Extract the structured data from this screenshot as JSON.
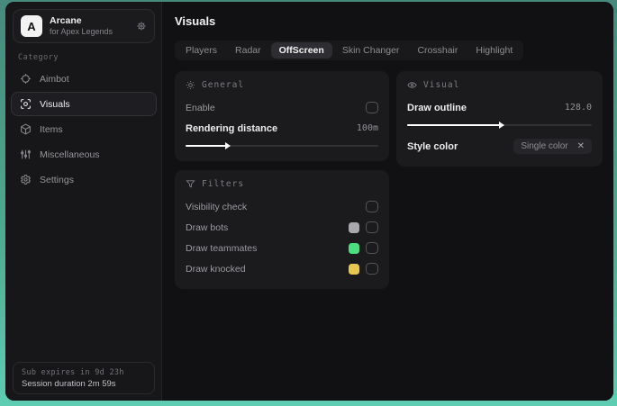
{
  "sidebar": {
    "app": {
      "logo_letter": "A",
      "name": "Arcane",
      "subtitle": "for Apex Legends"
    },
    "category_label": "Category",
    "items": [
      {
        "label": "Aimbot"
      },
      {
        "label": "Visuals"
      },
      {
        "label": "Items"
      },
      {
        "label": "Miscellaneous"
      },
      {
        "label": "Settings"
      }
    ],
    "footer": {
      "expires": "Sub expires in 9d 23h",
      "session": "Session duration 2m 59s"
    }
  },
  "main": {
    "title": "Visuals",
    "tabs": [
      {
        "label": "Players"
      },
      {
        "label": "Radar"
      },
      {
        "label": "OffScreen"
      },
      {
        "label": "Skin Changer"
      },
      {
        "label": "Crosshair"
      },
      {
        "label": "Highlight"
      }
    ],
    "general": {
      "title": "General",
      "enable_label": "Enable",
      "distance_label": "Rendering distance",
      "distance_value": "100m",
      "distance_fill": "21%"
    },
    "visual": {
      "title": "Visual",
      "outline_label": "Draw outline",
      "outline_value": "128.0",
      "outline_fill": "50%",
      "style_label": "Style color",
      "style_value": "Single color",
      "style_clear": "✕"
    },
    "filters": {
      "title": "Filters",
      "rows": [
        {
          "label": "Visibility check"
        },
        {
          "label": "Draw bots",
          "swatch": "#a9a9ad"
        },
        {
          "label": "Draw teammates",
          "swatch": "#4ade80"
        },
        {
          "label": "Draw knocked",
          "swatch": "#e8c94f"
        }
      ]
    }
  },
  "colors": {
    "background_teal": "#53c0a6",
    "panel": "#1b1b1e",
    "accent_white": "#ffffff"
  }
}
